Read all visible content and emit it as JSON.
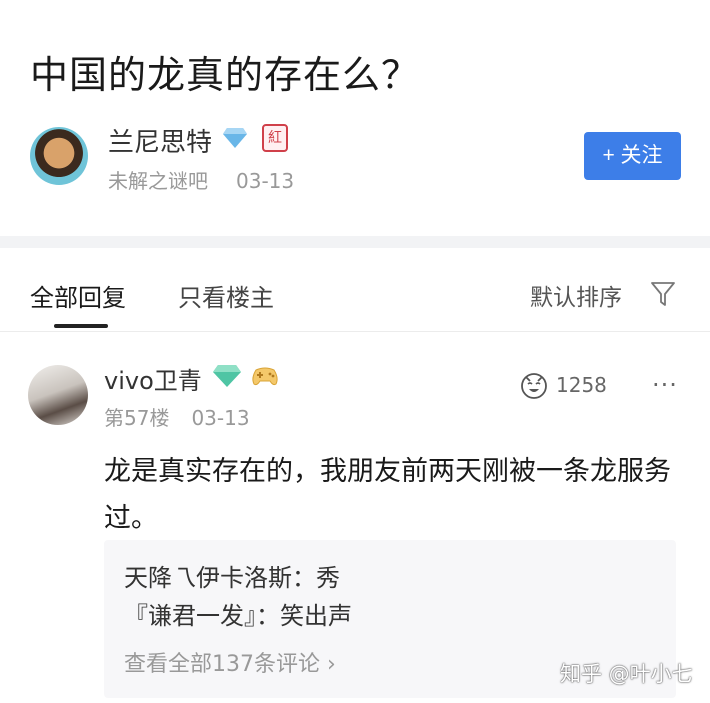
{
  "post": {
    "title": "中国的龙真的存在么？"
  },
  "author": {
    "name": "兰尼思特",
    "badge": "紅",
    "subtitle": "未解之谜吧",
    "date": "03-13",
    "follow_label": "+ 关注"
  },
  "tabs": [
    {
      "label": "全部回复",
      "selected": true
    },
    {
      "label": "只看楼主",
      "selected": false
    }
  ],
  "sort": {
    "label": "默认排序",
    "icon": "filter-icon"
  },
  "reply": {
    "user": "vivo卫青",
    "floor": "第57楼",
    "date": "03-13",
    "likes": "1258",
    "more": "···",
    "text": "龙是真实存在的，我朋友前两天刚被一条龙服务过。",
    "subreplies": [
      "天降乁伊卡洛斯：秀",
      "『谦君一发』：笑出声"
    ],
    "view_all": "查看全部137条评论 ›"
  },
  "watermark": "知乎 @叶小七",
  "colors": {
    "accent": "#3d7ee8",
    "badge": "#d0404a",
    "gem": "#69b6e8",
    "gem_green": "#4fc5a4"
  }
}
